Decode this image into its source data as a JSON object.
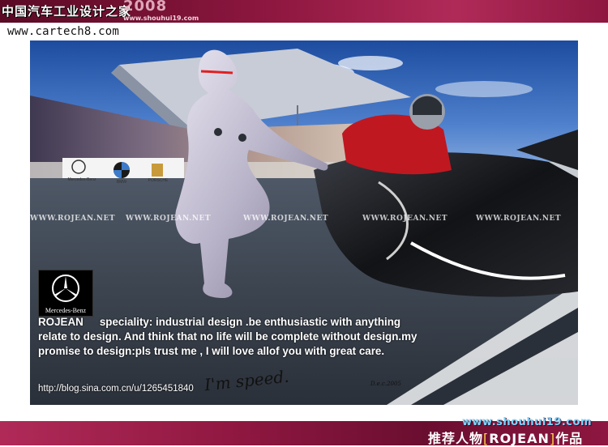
{
  "header": {
    "logo_text": "中国汽车工业设计之家",
    "logo_year": "2008",
    "logo_url": "www.shouhui19.com",
    "site_url": "www.cartech8.com"
  },
  "photo": {
    "watermark": "WWW.ROJEAN.NET",
    "sponsors": [
      "Mercedes-Benz",
      "BMW",
      "PORSCHE"
    ],
    "brand_logo_text": "Mercedes-Benz",
    "bio_name": "ROJEAN",
    "bio_text": "speciality: industrial design .be enthusiastic with anything relate to design. And think that no life will be complete without design.my promise to design:pls trust me , I will love allof you with great care.",
    "blog_url": "http://blog.sina.com.cn/u/1265451840",
    "signature": "I'm speed.",
    "signature_date": "D.e.c.2005"
  },
  "footer": {
    "site": "www.shouhui19.com",
    "tag_prefix": "推荐人物",
    "tag_name": "ROJEAN",
    "tag_suffix": "作品"
  },
  "colors": {
    "bar": "#8e1740",
    "sky": "#2f5fb0",
    "track": "#3c4450"
  }
}
